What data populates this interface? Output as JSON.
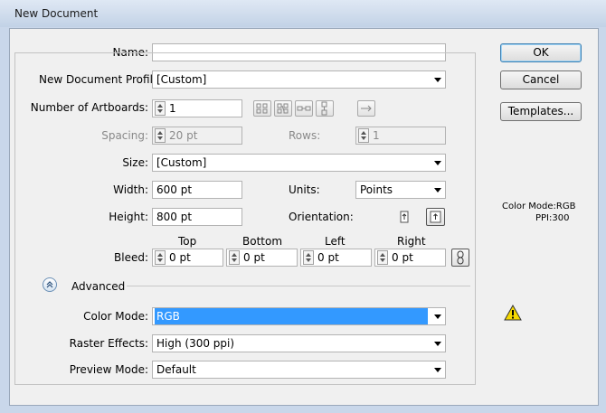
{
  "window": {
    "title": "New Document"
  },
  "name_label": "Name:",
  "name_value": "",
  "profile": {
    "label": "New Document Profile:",
    "value": "[Custom]"
  },
  "artboards": {
    "label": "Number of Artboards:",
    "value": "1"
  },
  "spacing": {
    "label": "Spacing:",
    "value": "20 pt"
  },
  "rows": {
    "label": "Rows:",
    "value": "1"
  },
  "size": {
    "label": "Size:",
    "value": "[Custom]"
  },
  "width": {
    "label": "Width:",
    "value": "600 pt"
  },
  "units": {
    "label": "Units:",
    "value": "Points"
  },
  "height": {
    "label": "Height:",
    "value": "800 pt"
  },
  "orientation": {
    "label": "Orientation:"
  },
  "bleed": {
    "label": "Bleed:",
    "top_label": "Top",
    "bottom_label": "Bottom",
    "left_label": "Left",
    "right_label": "Right",
    "top": "0 pt",
    "bottom": "0 pt",
    "left": "0 pt",
    "right": "0 pt"
  },
  "advanced": {
    "label": "Advanced"
  },
  "color_mode": {
    "label": "Color Mode:",
    "value": "RGB"
  },
  "raster_effects": {
    "label": "Raster Effects:",
    "value": "High (300 ppi)"
  },
  "preview_mode": {
    "label": "Preview Mode:",
    "value": "Default"
  },
  "buttons": {
    "ok": "OK",
    "cancel": "Cancel",
    "templates": "Templates..."
  },
  "summary": {
    "color_mode": "Color Mode:RGB",
    "ppi": "PPI:300"
  },
  "colors": {
    "selection": "#3399ff",
    "warning": "#f5d800"
  }
}
